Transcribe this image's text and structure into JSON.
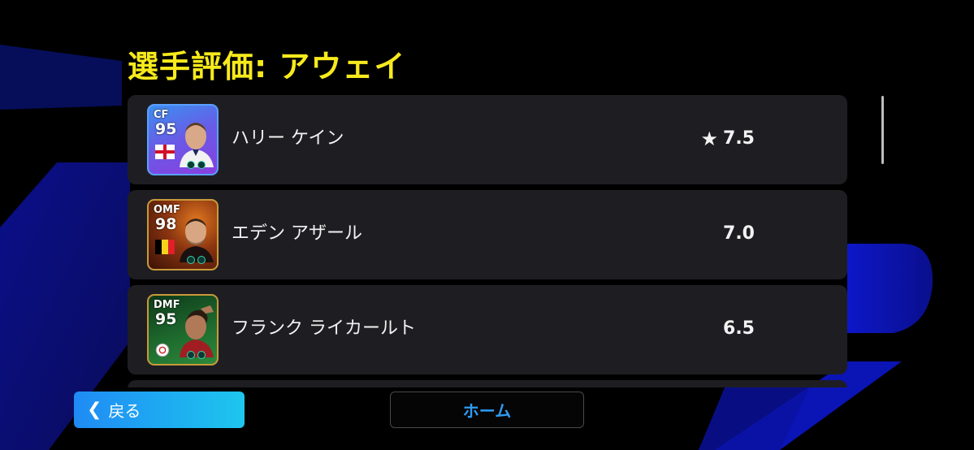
{
  "header": {
    "title": "選手評価: アウェイ"
  },
  "players": [
    {
      "position": "CF",
      "overall": "95",
      "name": "ハリー ケイン",
      "rating": "7.5",
      "has_star": true,
      "nation_flag": "england-flag",
      "card_colors": {
        "top": "#3c8ff0",
        "bottom": "#8a3fe0",
        "border": "#5aa0ff"
      }
    },
    {
      "position": "OMF",
      "overall": "98",
      "name": "エデン アザール",
      "rating": "7.0",
      "has_star": false,
      "nation_flag": "belgium-flag",
      "card_colors": {
        "top": "#3a1206",
        "bottom": "#c8601a",
        "border": "#c99a3a"
      }
    },
    {
      "position": "DMF",
      "overall": "95",
      "name": "フランク ライカールト",
      "rating": "6.5",
      "has_star": false,
      "nation_flag": "club-crest",
      "card_colors": {
        "top": "#0e3a1a",
        "bottom": "#2d8a3c",
        "border": "#c99a3a"
      }
    }
  ],
  "footer": {
    "back_label": "戻る",
    "home_label": "ホーム"
  },
  "colors": {
    "title": "#f7ea1c",
    "accent_blue": "#1f8bf5",
    "row_bg": "#1e1e22"
  }
}
